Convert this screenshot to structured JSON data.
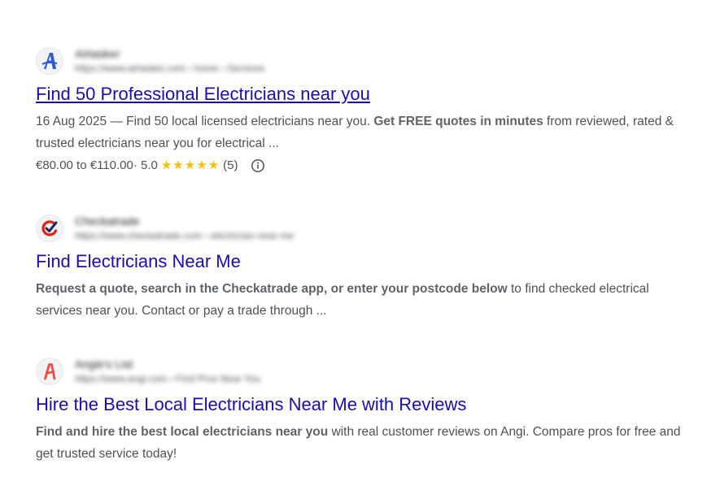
{
  "results": [
    {
      "site_name": "Airtasker",
      "site_url": "https://www.airtasker.com › home › Services",
      "title": "Find 50 Professional Electricians near you",
      "date": "16 Aug 2025",
      "snippet_lead": " — Find 50 local licensed electricians near you. ",
      "snippet_bold": "Get FREE quotes in minutes",
      "snippet_tail": " from reviewed, rated & trusted electricians near you for electrical ...",
      "price_range": "€80.00 to €110.00",
      "rating_prefix": " · 5.0",
      "stars": "★★★★★",
      "review_count": "(5)",
      "favicon": "airtasker-a-icon",
      "accent": "#2a5bd7"
    },
    {
      "site_name": "Checkatrade",
      "site_url": "https://www.checkatrade.com › electrician-near-me",
      "title": "Find Electricians Near Me",
      "snippet_bold": "Request a quote, search in the Checkatrade app, or enter your postcode below",
      "snippet_tail": " to find checked electrical services near you. Contact or pay a trade through ...",
      "favicon": "checkatrade-check-icon",
      "accent": "#e0261b"
    },
    {
      "site_name": "Angie's List",
      "site_url": "https://www.angi.com › Find Pros Near You",
      "title": "Hire the Best Local Electricians Near Me with Reviews",
      "snippet_bold": "Find and hire the best local electricians near you",
      "snippet_tail": " with real customer reviews on Angi. Compare pros for free and get trusted service today!",
      "favicon": "angi-a-icon",
      "accent": "#ef4b3f"
    }
  ],
  "colors": {
    "link": "#1a0dab",
    "text": "#4d5156",
    "star": "#fbbc04"
  }
}
